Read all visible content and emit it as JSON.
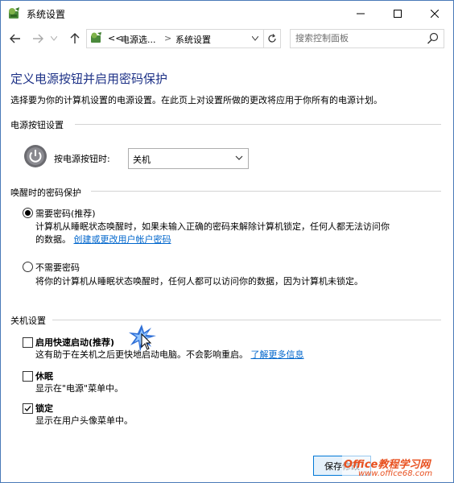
{
  "window": {
    "title": "系统设置",
    "minimize": "—",
    "maximize": "□",
    "close": "✕"
  },
  "nav": {
    "back": "←",
    "forward": "→",
    "dropdown": "∨",
    "up": "↑",
    "chevron": "<<",
    "crumb1": "电源选...",
    "sep": ">",
    "crumb2": "系统设置",
    "addr_dropdown": "∨",
    "refresh": "↻",
    "search_placeholder": "搜索控制面板"
  },
  "page": {
    "heading": "定义电源按钮并启用密码保护",
    "subtitle": "选择要为你的计算机设置的电源设置。在此页上对设置所做的更改将应用于你所有的电源计划。"
  },
  "power_buttons": {
    "section": "电源按钮设置",
    "label": "按电源按钮时:",
    "selected": "关机"
  },
  "wake_password": {
    "section": "唤醒时的密码保护",
    "options": [
      {
        "label": "需要密码(推荐)",
        "desc_line1": "计算机从睡眠状态唤醒时，如果未输入正确的密码来解除计算机锁定，任何人都无法访问你",
        "desc_line2": "的数据。",
        "link": "创建或更改用户帐户密码",
        "selected": true
      },
      {
        "label": "不需要密码",
        "desc_line1": "将你的计算机从睡眠状态唤醒时，任何人都可以访问你的数据，因为计算机未锁定。",
        "selected": false
      }
    ]
  },
  "shutdown": {
    "section": "关机设置",
    "options": [
      {
        "label": "启用快速启动(推荐)",
        "desc": "这有助于在关机之后更快地启动电脑。不会影响重启。",
        "link": "了解更多信息",
        "checked": false
      },
      {
        "label": "休眠",
        "desc": "显示在\"电源\"菜单中。",
        "checked": false
      },
      {
        "label": "锁定",
        "desc": "显示在用户头像菜单中。",
        "checked": true
      }
    ]
  },
  "footer": {
    "save": "保存修改"
  },
  "watermark": {
    "line1": "Office教程学习网",
    "line2": "www.office68.com"
  }
}
